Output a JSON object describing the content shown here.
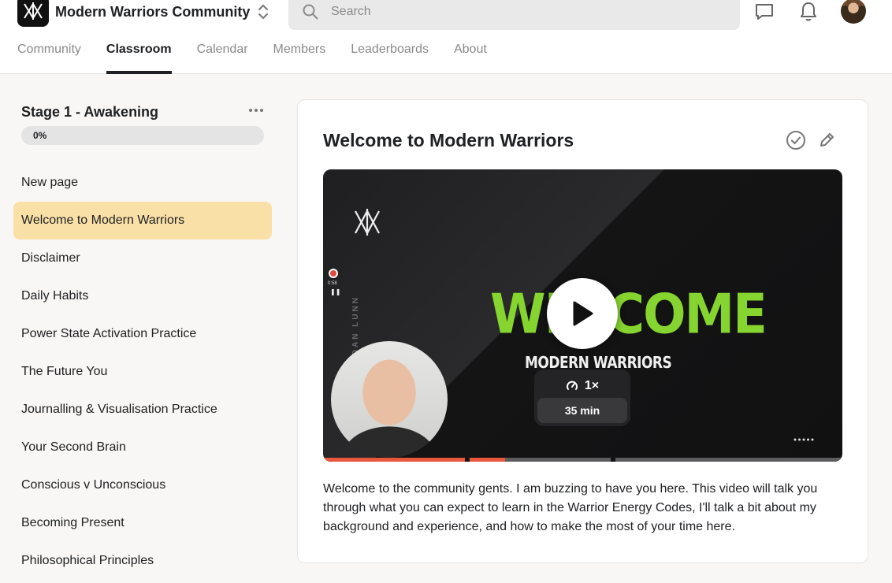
{
  "header": {
    "community_name": "Modern Warriors Community",
    "search": {
      "placeholder": "Search",
      "value": ""
    },
    "icons": [
      "logo-icon",
      "switcher-icon",
      "search-icon",
      "chat-icon",
      "bell-icon",
      "avatar"
    ]
  },
  "tabs": [
    {
      "label": "Community",
      "active": false
    },
    {
      "label": "Classroom",
      "active": true
    },
    {
      "label": "Calendar",
      "active": false
    },
    {
      "label": "Members",
      "active": false
    },
    {
      "label": "Leaderboards",
      "active": false
    },
    {
      "label": "About",
      "active": false
    }
  ],
  "sidebar": {
    "course_title": "Stage 1 - Awakening",
    "progress": {
      "label": "0%",
      "percent": 0
    },
    "lessons": [
      {
        "label": "New page",
        "active": false
      },
      {
        "label": "Welcome to Modern Warriors",
        "active": true
      },
      {
        "label": "Disclaimer",
        "active": false
      },
      {
        "label": "Daily Habits",
        "active": false
      },
      {
        "label": "Power State Activation Practice",
        "active": false
      },
      {
        "label": "The Future You",
        "active": false
      },
      {
        "label": "Journalling & Visualisation Practice",
        "active": false
      },
      {
        "label": "Your Second Brain",
        "active": false
      },
      {
        "label": "Conscious v Unconscious",
        "active": false
      },
      {
        "label": "Becoming Present",
        "active": false
      },
      {
        "label": "Philosophical Principles",
        "active": false
      }
    ]
  },
  "lesson": {
    "title": "Welcome to Modern Warriors",
    "video": {
      "headline": "WELCOME",
      "subheadline": "MODERN WARRIORS",
      "vertical_text": "DAN LUNN",
      "speed": "1×",
      "duration": "35 min",
      "progress_fraction": 0.35
    },
    "description": "Welcome to the community gents. I am buzzing to have you here. This video will talk you through what you can expect to learn in the Warrior Energy Codes, I'll talk a bit about my background and experience, and how to make the most of your time here."
  },
  "colors": {
    "active_lesson_bg": "#f9e0a6",
    "progress_bar": "#e9573c",
    "headline_green": "#86d42f"
  }
}
